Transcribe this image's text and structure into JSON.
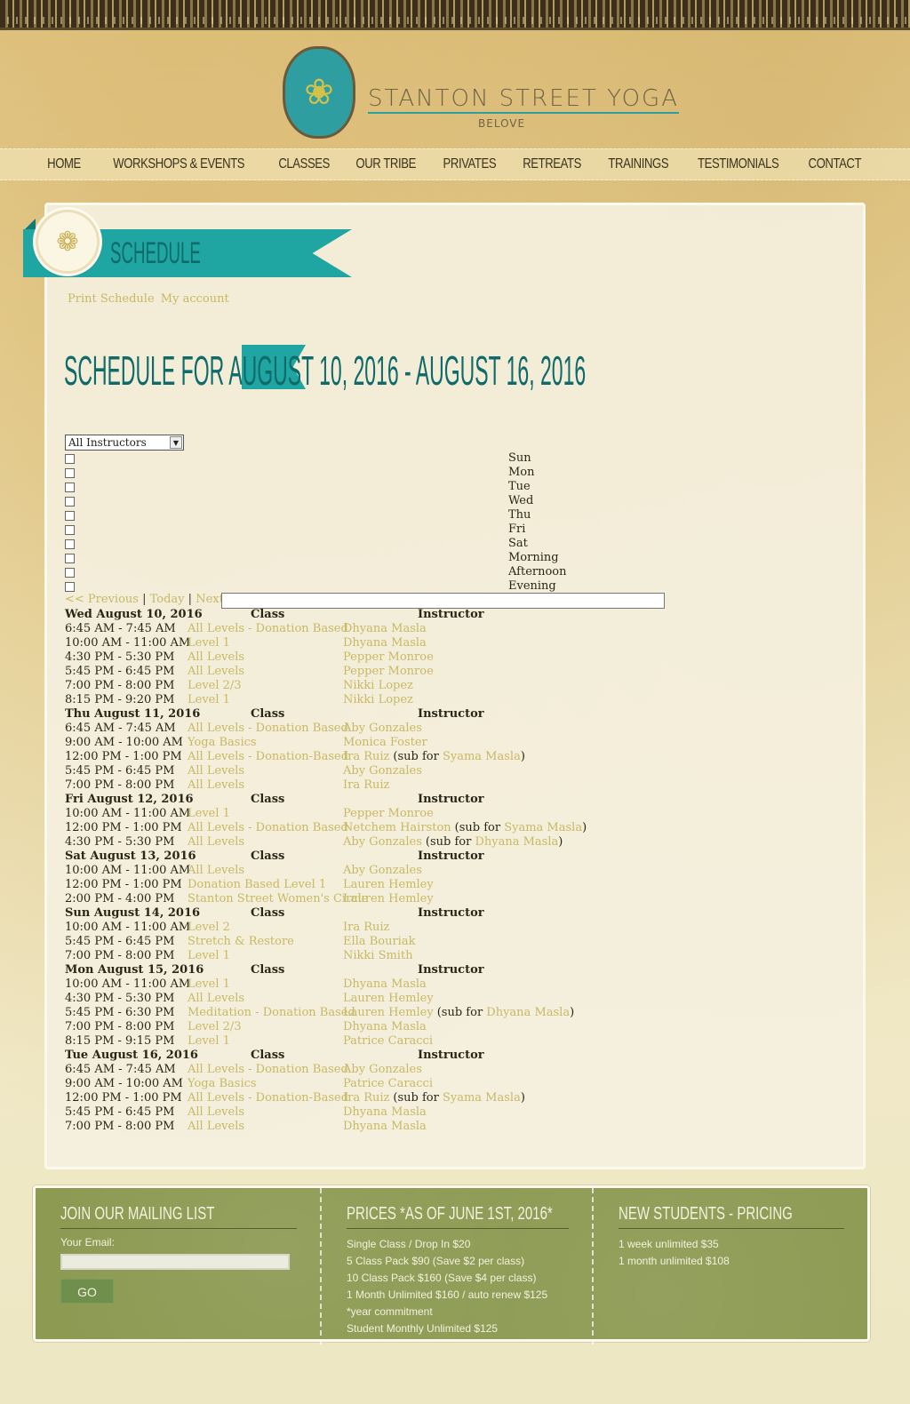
{
  "site": {
    "name": "STANTON STREET YOGA",
    "tagline": "BELOVE"
  },
  "nav": [
    "HOME",
    "WORKSHOPS & EVENTS",
    "CLASSES",
    "OUR TRIBE",
    "PRIVATES",
    "RETREATS",
    "TRAININGS",
    "TESTIMONIALS",
    "CONTACT"
  ],
  "page": {
    "title": "SCHEDULE",
    "links": [
      "Print Schedule",
      "My account"
    ],
    "heading": "SCHEDULE FOR AUGUST 10, 2016 - AUGUST 16, 2016"
  },
  "filters": {
    "instructor_select": "All Instructors",
    "options": [
      "Sun",
      "Mon",
      "Tue",
      "Wed",
      "Thu",
      "Fri",
      "Sat",
      "Morning",
      "Afternoon",
      "Evening"
    ]
  },
  "pager": {
    "previous": "<< Previous",
    "today": "Today",
    "next": "Next >>",
    "sep": "|"
  },
  "columns": {
    "class": "Class",
    "instructor": "Instructor"
  },
  "days": [
    {
      "date": "Wed August 10, 2016",
      "rows": [
        {
          "time": "6:45 AM - 7:45 AM",
          "class": "All Levels - Donation Based",
          "instructor": "Dhyana Masla"
        },
        {
          "time": "10:00 AM - 11:00 AM",
          "class": "Level 1",
          "instructor": "Dhyana Masla"
        },
        {
          "time": "4:30 PM - 5:30 PM",
          "class": "All Levels",
          "instructor": "Pepper Monroe"
        },
        {
          "time": "5:45 PM - 6:45 PM",
          "class": "All Levels",
          "instructor": "Pepper Monroe"
        },
        {
          "time": "7:00 PM - 8:00 PM",
          "class": "Level 2/3",
          "instructor": "Nikki Lopez"
        },
        {
          "time": "8:15 PM - 9:20 PM",
          "class": "Level 1",
          "instructor": "Nikki Lopez"
        }
      ]
    },
    {
      "date": "Thu August 11, 2016",
      "rows": [
        {
          "time": "6:45 AM - 7:45 AM",
          "class": "All Levels - Donation Based",
          "instructor": "Aby Gonzales"
        },
        {
          "time": "9:00 AM - 10:00 AM",
          "class": "Yoga Basics",
          "instructor": "Monica Foster"
        },
        {
          "time": "12:00 PM - 1:00 PM",
          "class": "All Levels - Donation-Based",
          "instructor": "Ira Ruiz",
          "sub": "Syama Masla"
        },
        {
          "time": "5:45 PM - 6:45 PM",
          "class": "All Levels",
          "instructor": "Aby Gonzales"
        },
        {
          "time": "7:00 PM - 8:00 PM",
          "class": "All Levels",
          "instructor": "Ira Ruiz"
        }
      ]
    },
    {
      "date": "Fri August 12, 2016",
      "rows": [
        {
          "time": "10:00 AM - 11:00 AM",
          "class": "Level 1",
          "instructor": "Pepper Monroe"
        },
        {
          "time": "12:00 PM - 1:00 PM",
          "class": "All Levels - Donation Based",
          "instructor": "Netchem Hairston",
          "sub": "Syama Masla"
        },
        {
          "time": "4:30 PM - 5:30 PM",
          "class": "All Levels",
          "instructor": "Aby Gonzales",
          "sub": "Dhyana Masla"
        }
      ]
    },
    {
      "date": "Sat August 13, 2016",
      "rows": [
        {
          "time": "10:00 AM - 11:00 AM",
          "class": "All Levels",
          "instructor": "Aby Gonzales"
        },
        {
          "time": "12:00 PM - 1:00 PM",
          "class": "Donation Based Level 1",
          "instructor": "Lauren Hemley"
        },
        {
          "time": "2:00 PM - 4:00 PM",
          "class": "Stanton Street Women's Circle",
          "instructor": "Lauren Hemley"
        }
      ]
    },
    {
      "date": "Sun August 14, 2016",
      "rows": [
        {
          "time": "10:00 AM - 11:00 AM",
          "class": "Level 2",
          "instructor": "Ira Ruiz"
        },
        {
          "time": "5:45 PM - 6:45 PM",
          "class": "Stretch & Restore",
          "instructor": "Ella Bouriak"
        },
        {
          "time": "7:00 PM - 8:00 PM",
          "class": "Level 1",
          "instructor": "Nikki Smith"
        }
      ]
    },
    {
      "date": "Mon August 15, 2016",
      "rows": [
        {
          "time": "10:00 AM - 11:00 AM",
          "class": "Level 1",
          "instructor": "Dhyana Masla"
        },
        {
          "time": "4:30 PM - 5:30 PM",
          "class": "All Levels",
          "instructor": "Lauren Hemley"
        },
        {
          "time": "5:45 PM - 6:30 PM",
          "class": "Meditation - Donation Based",
          "instructor": "Lauren Hemley",
          "sub": "Dhyana Masla"
        },
        {
          "time": "7:00 PM - 8:00 PM",
          "class": "Level 2/3",
          "instructor": "Dhyana Masla"
        },
        {
          "time": "8:15 PM - 9:15 PM",
          "class": "Level 1",
          "instructor": "Patrice Caracci"
        }
      ]
    },
    {
      "date": "Tue August 16, 2016",
      "rows": [
        {
          "time": "6:45 AM - 7:45 AM",
          "class": "All Levels - Donation Based",
          "instructor": "Aby Gonzales"
        },
        {
          "time": "9:00 AM - 10:00 AM",
          "class": "Yoga Basics",
          "instructor": "Patrice Caracci"
        },
        {
          "time": "12:00 PM - 1:00 PM",
          "class": "All Levels - Donation-Based",
          "instructor": "Ira Ruiz",
          "sub": "Syama Masla"
        },
        {
          "time": "5:45 PM - 6:45 PM",
          "class": "All Levels",
          "instructor": "Dhyana Masla"
        },
        {
          "time": "7:00 PM - 8:00 PM",
          "class": "All Levels",
          "instructor": "Dhyana Masla"
        }
      ]
    }
  ],
  "sub_prefix": "(sub for ",
  "sub_suffix": ")",
  "footer": {
    "mailing": {
      "title": "JOIN OUR MAILING LIST",
      "email_label": "Your Email:",
      "button": "GO"
    },
    "prices": {
      "title": "PRICES *AS OF JUNE 1ST, 2016*",
      "lines": [
        "Single Class / Drop In $20",
        "5 Class Pack $90 (Save $2 per class)",
        "10 Class Pack $160 (Save $4 per class)",
        "1 Month Unlimited $160 / auto renew $125",
        "*year commitment",
        "Student Monthly Unlimited $125"
      ]
    },
    "new_students": {
      "title": "NEW STUDENTS - PRICING",
      "lines": [
        "1 week unlimited $35",
        "1 month unlimited $108"
      ]
    }
  },
  "colors": {
    "accent_teal": "#1fa6a3",
    "link_gold": "#c9b864",
    "footer_green": "#8c9a52"
  },
  "icons": {
    "logo": "lotus-icon",
    "medallion": "lotus-medallion-icon",
    "select": "chevron-down-icon"
  }
}
